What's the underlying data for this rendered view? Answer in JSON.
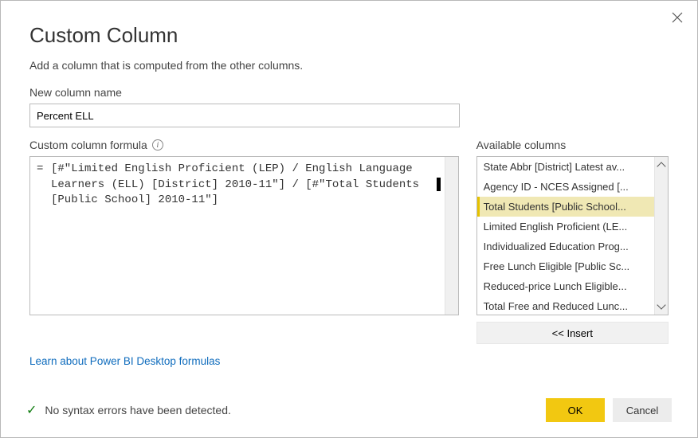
{
  "dialog": {
    "title": "Custom Column",
    "subtitle": "Add a column that is computed from the other columns."
  },
  "newColumn": {
    "label": "New column name",
    "value": "Percent ELL"
  },
  "formula": {
    "label": "Custom column formula",
    "expression": "[#\"Limited English Proficient (LEP) / English Language Learners (ELL) [District] 2010-11\"] / [#\"Total Students [Public School] 2010-11\"]"
  },
  "available": {
    "label": "Available columns",
    "items": [
      "State Abbr [District] Latest av...",
      "Agency ID - NCES Assigned [...",
      "Total Students [Public School...",
      "Limited English Proficient (LE...",
      "Individualized Education Prog...",
      "Free Lunch Eligible [Public Sc...",
      "Reduced-price Lunch Eligible...",
      "Total Free and Reduced Lunc..."
    ],
    "selectedIndex": 2,
    "insertLabel": "<< Insert"
  },
  "learnLink": "Learn about Power BI Desktop formulas",
  "status": {
    "message": "No syntax errors have been detected."
  },
  "buttons": {
    "ok": "OK",
    "cancel": "Cancel"
  }
}
